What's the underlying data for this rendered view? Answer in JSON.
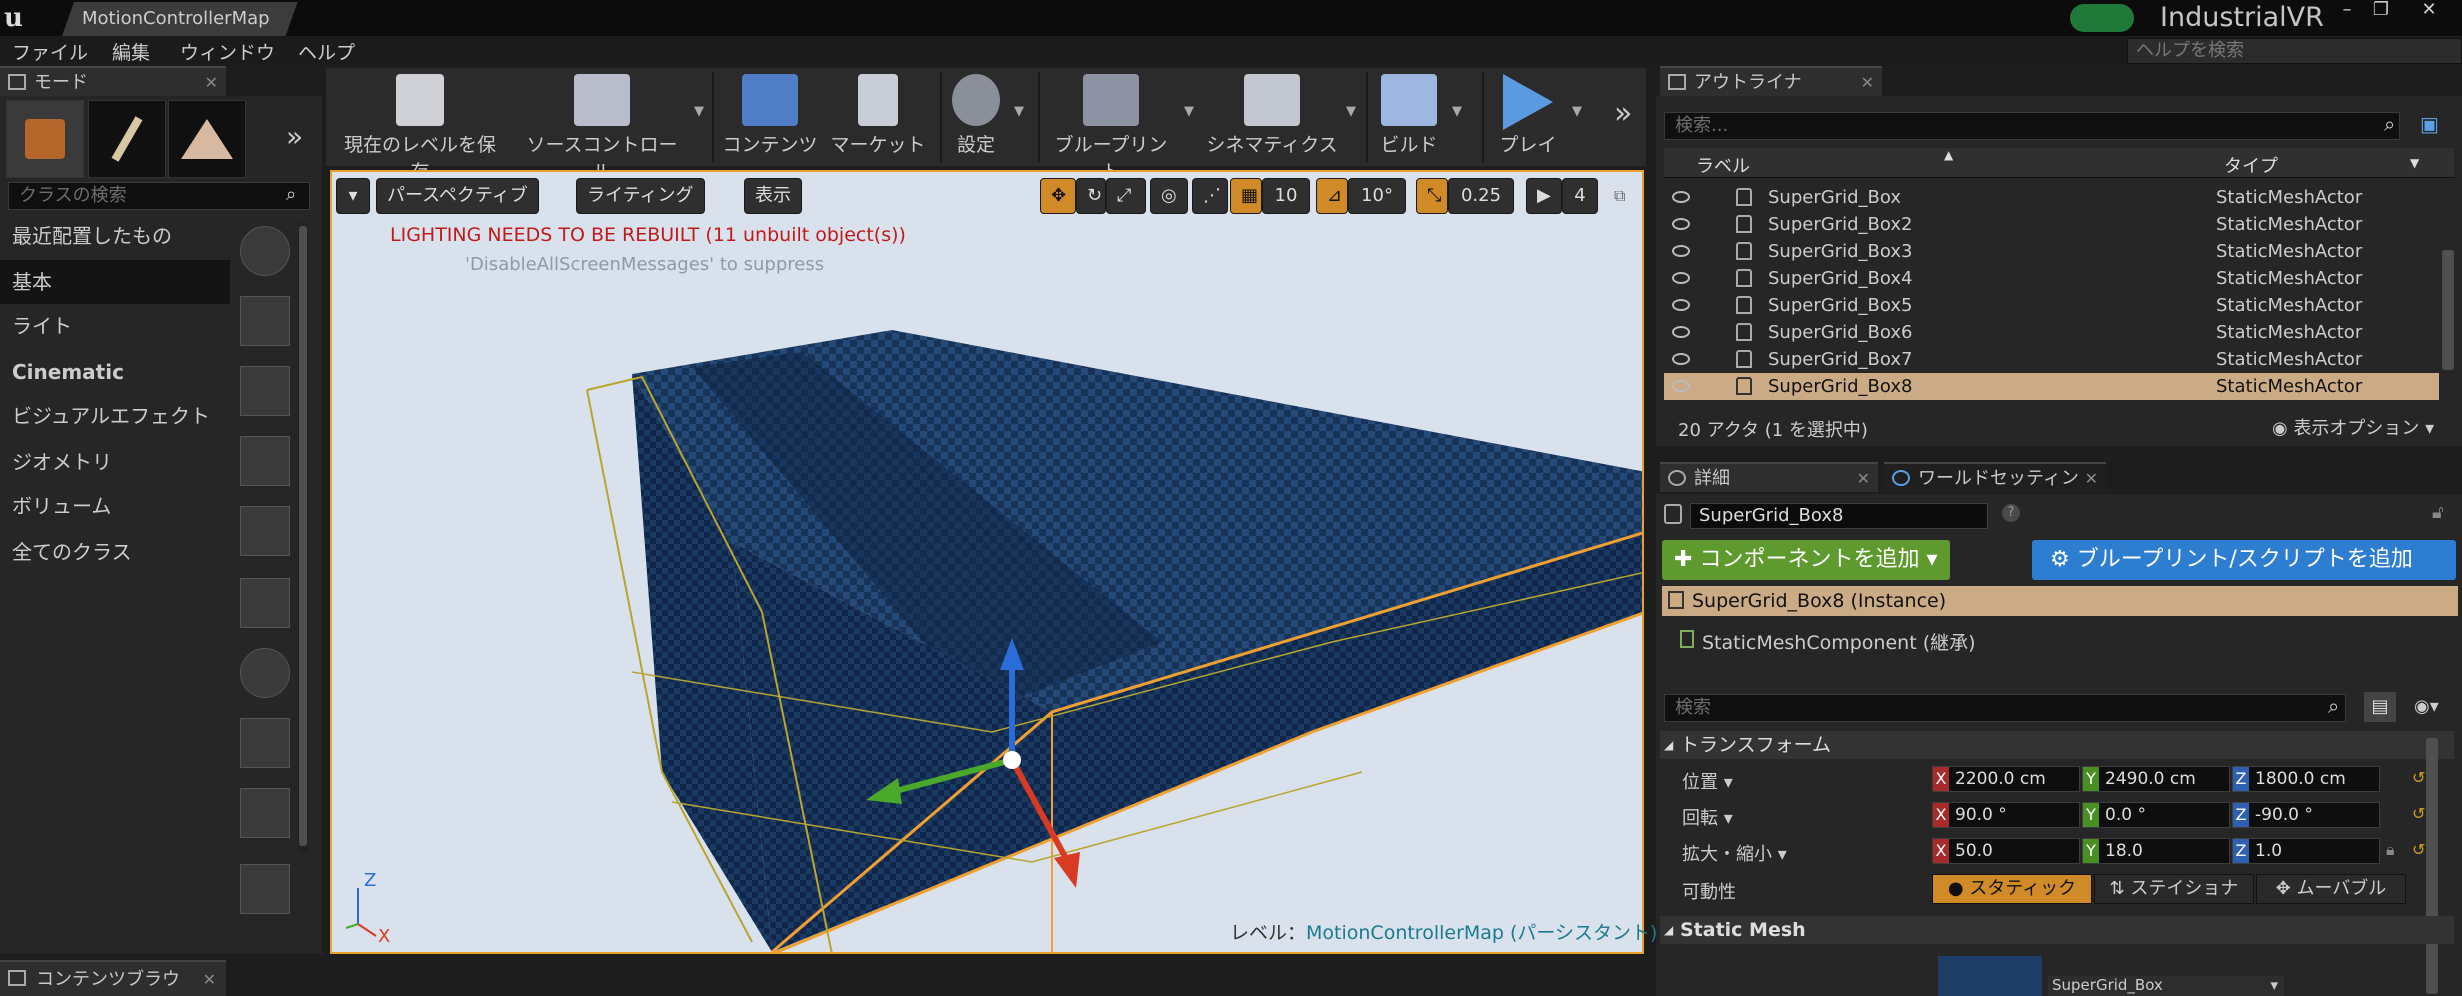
{
  "window": {
    "tab_title": "MotionControllerMap",
    "project_name": "IndustrialVR",
    "help_search_placeholder": "ヘルプを検索"
  },
  "menu": [
    "ファイル",
    "編集",
    "ウィンドウ",
    "ヘルプ"
  ],
  "modes": {
    "tab_label": "モード",
    "search_placeholder": "クラスの検索",
    "categories": [
      "最近配置したもの",
      "基本",
      "ライト",
      "Cinematic",
      "ビジュアルエフェクト",
      "ジオメトリ",
      "ボリューム",
      "全てのクラス"
    ]
  },
  "toolbar": {
    "buttons": [
      "現在のレベルを保存",
      "ソースコントロール",
      "コンテンツ",
      "マーケット",
      "設定",
      "ブループリント",
      "シネマティクス",
      "ビルド",
      "プレイ"
    ]
  },
  "viewport": {
    "perspective": "パースペクティブ",
    "lighting": "ライティング",
    "show": "表示",
    "grid_snap": "10",
    "rot_snap": "10°",
    "scale_snap": "0.25",
    "cam_speed": "4",
    "warning": "LIGHTING NEEDS TO BE REBUILT (11 unbuilt object(s))",
    "suppress": "'DisableAllScreenMessages' to suppress",
    "level_label": "レベル：",
    "level_name": "MotionControllerMap (パーシスタント)"
  },
  "outliner": {
    "tab_label": "アウトライナ",
    "search_placeholder": "検索...",
    "col_label": "ラベル",
    "col_type": "タイプ",
    "rows": [
      {
        "label": "SuperGrid_Box",
        "type": "StaticMeshActor"
      },
      {
        "label": "SuperGrid_Box2",
        "type": "StaticMeshActor"
      },
      {
        "label": "SuperGrid_Box3",
        "type": "StaticMeshActor"
      },
      {
        "label": "SuperGrid_Box4",
        "type": "StaticMeshActor"
      },
      {
        "label": "SuperGrid_Box5",
        "type": "StaticMeshActor"
      },
      {
        "label": "SuperGrid_Box6",
        "type": "StaticMeshActor"
      },
      {
        "label": "SuperGrid_Box7",
        "type": "StaticMeshActor"
      },
      {
        "label": "SuperGrid_Box8",
        "type": "StaticMeshActor"
      }
    ],
    "count": "20 アクタ (1 を選択中)",
    "view_options": "表示オプション"
  },
  "details": {
    "tab_label": "詳細",
    "world_tab_label": "ワールドセッティン",
    "name": "SuperGrid_Box8",
    "add_component": "コンポーネントを追加",
    "add_blueprint": "ブループリント/スクリプトを追加",
    "instance": "SuperGrid_Box8 (Instance)",
    "component": "StaticMeshComponent (継承)",
    "search_placeholder": "検索",
    "transform_header": "トランスフォーム",
    "location_label": "位置",
    "rotation_label": "回転",
    "scale_label": "拡大・縮小",
    "mobility_label": "可動性",
    "location": {
      "x": "2200.0 cm",
      "y": "2490.0 cm",
      "z": "1800.0 cm"
    },
    "rotation": {
      "x": "90.0 °",
      "y": "0.0 °",
      "z": "-90.0 °"
    },
    "scale": {
      "x": "50.0",
      "y": "18.0",
      "z": "1.0"
    },
    "mobility": [
      "スタティック",
      "ステイショナ",
      "ムーバブル"
    ],
    "static_mesh_header": "Static Mesh",
    "mesh_name": "SuperGrid_Box"
  },
  "bottom": {
    "content_browser_tab": "コンテンツブラウ"
  },
  "colors": {
    "accent": "#e8a02b",
    "selected_row": "#cbab86",
    "add_component": "#5e9a2e",
    "add_blueprint": "#2d7dd0"
  }
}
